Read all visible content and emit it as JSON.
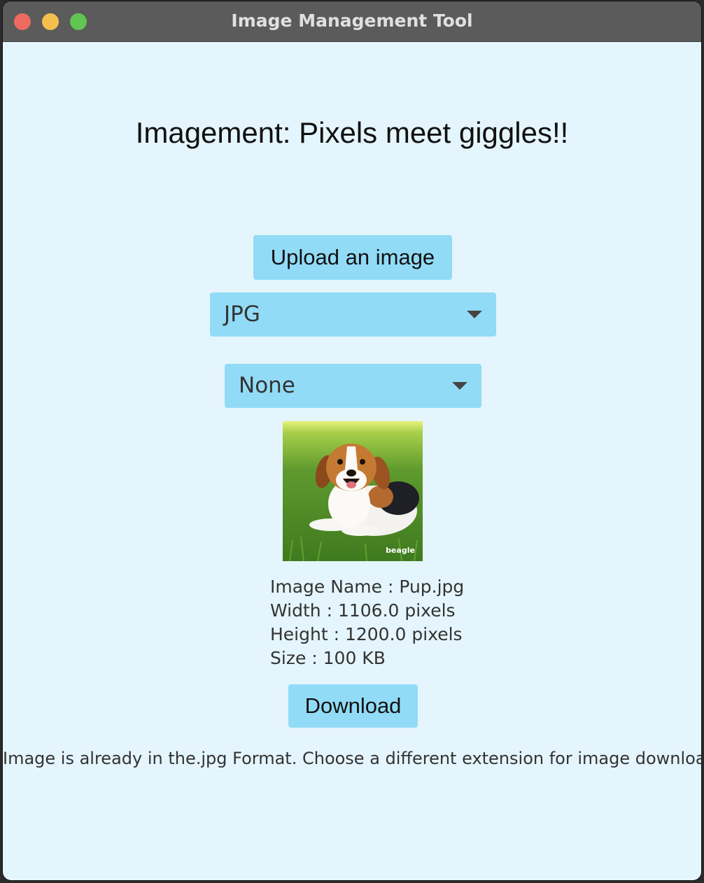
{
  "window": {
    "title": "Image Management Tool"
  },
  "headline": "Imagement: Pixels meet giggles!!",
  "upload_button": "Upload an image",
  "format_dropdown": {
    "selected": "JPG",
    "icon": "chevron-down-icon"
  },
  "filter_dropdown": {
    "selected": "None",
    "icon": "chevron-down-icon"
  },
  "preview": {
    "watermark": "beagle",
    "subject": "beagle puppy on grass"
  },
  "image_info": {
    "name": "Image Name : Pup.jpg",
    "width": "Width : 1106.0 pixels",
    "height": "Height : 1200.0 pixels",
    "size": "Size : 100 KB"
  },
  "download_button": "Download",
  "status_message": "Image is already in the.jpg Format. Choose a different extension for image download.",
  "colors": {
    "window_bg": "#e4f5fd",
    "button_bg": "#92dbf7",
    "titlebar": "#5b5b5b",
    "close": "#ed6a5e",
    "minimize": "#f5bf4f",
    "maximize": "#61c554"
  }
}
